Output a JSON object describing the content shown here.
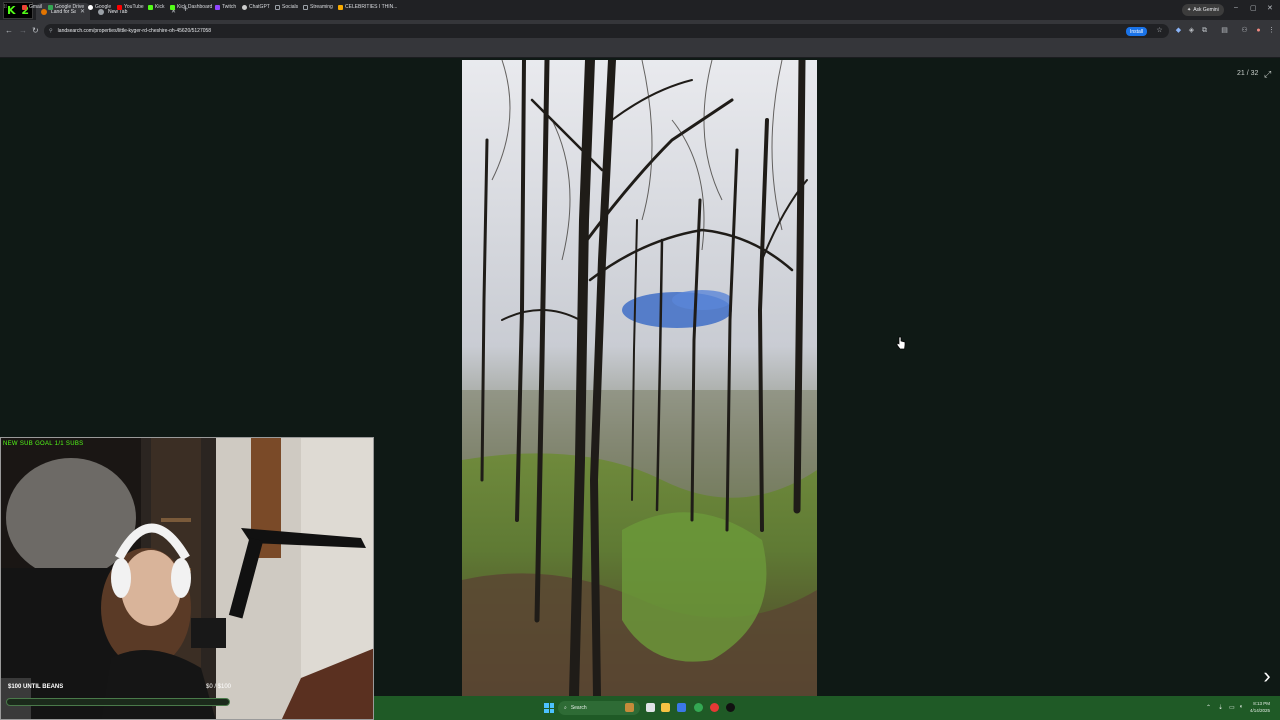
{
  "stream_badge": {
    "letter": "K",
    "number": "2"
  },
  "tabs": [
    {
      "title": "Land for Sale in Ch",
      "active": true
    },
    {
      "title": "New Tab",
      "active": false
    }
  ],
  "new_tab_symbol": "+",
  "ask_gemini": "Ask Gemini",
  "window_controls": {
    "minimize": "–",
    "maximize": "▢",
    "close": "✕"
  },
  "omnibox": {
    "url": "landsearch.com/properties/little-kyger-rd-cheshire-oh-45620/5127058"
  },
  "install_label": "Install",
  "bookmarks": [
    {
      "label": "Gmail",
      "color": "#ea4335"
    },
    {
      "label": "Google Drive",
      "color": "#34a853"
    },
    {
      "label": "Google",
      "color": "#ffffff"
    },
    {
      "label": "YouTube",
      "color": "#ff0000"
    },
    {
      "label": "Kick",
      "color": "#53fc18"
    },
    {
      "label": "Kick Dashboard",
      "color": "#53fc18"
    },
    {
      "label": "Twitch",
      "color": "#9146ff"
    },
    {
      "label": "ChatGPT",
      "color": "#cccccc"
    },
    {
      "label": "Socials",
      "color": "#9aa0a6"
    },
    {
      "label": "Streaming",
      "color": "#9aa0a6"
    },
    {
      "label": "CELEBRITIES I THIN...",
      "color": "#f9ab00"
    }
  ],
  "viewer": {
    "counter": "21 / 32",
    "next_symbol": "›"
  },
  "webcam": {
    "top_label": "NEW SUB GOAL 1/1 SUBS",
    "goal_left": "$100 UNTIL BEANS",
    "goal_right": "$0 / $100",
    "goal_progress": 0.0
  },
  "taskbar": {
    "search_placeholder": "Search",
    "time": "8:13 PM",
    "date": "4/14/2025"
  },
  "colors": {
    "page_bg": "#0f1915",
    "taskbar": "#1f5a26",
    "kick_green": "#53fc18",
    "chrome_dark": "#202124",
    "chrome_toolbar": "#35363a"
  }
}
